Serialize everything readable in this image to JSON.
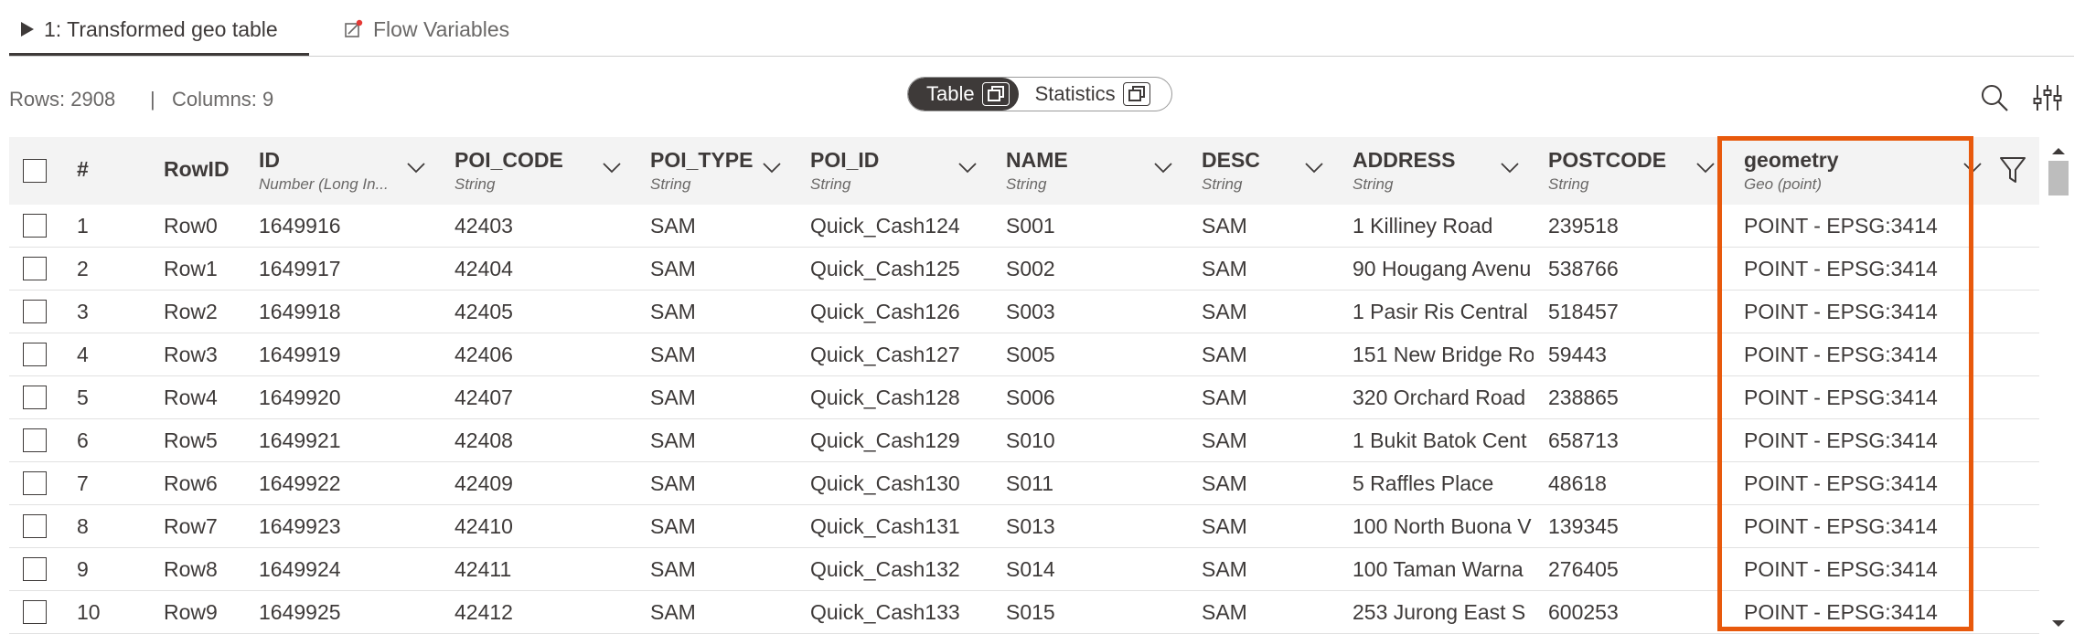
{
  "tabs": [
    {
      "label": "1: Transformed geo table",
      "icon": "play-icon"
    },
    {
      "label": "Flow Variables",
      "icon": "flow-variable-icon"
    }
  ],
  "info": {
    "rows": "Rows: 2908",
    "separator": "|",
    "columns": "Columns: 9"
  },
  "view_toggle": {
    "table": "Table",
    "statistics": "Statistics",
    "selected": "Table"
  },
  "columns": [
    {
      "name": "#"
    },
    {
      "name": "RowID"
    },
    {
      "name": "ID",
      "type": "Number (Long In..."
    },
    {
      "name": "POI_CODE",
      "type": "String"
    },
    {
      "name": "POI_TYPE",
      "type": "String"
    },
    {
      "name": "POI_ID",
      "type": "String"
    },
    {
      "name": "NAME",
      "type": "String"
    },
    {
      "name": "DESC",
      "type": "String"
    },
    {
      "name": "ADDRESS",
      "type": "String"
    },
    {
      "name": "POSTCODE",
      "type": "String"
    },
    {
      "name": "geometry",
      "type": "Geo (point)"
    }
  ],
  "rows": [
    [
      "1",
      "Row0",
      "1649916",
      "42403",
      "SAM",
      "Quick_Cash124",
      "S001",
      "SAM",
      "1 Killiney Road",
      "239518",
      "POINT - EPSG:3414"
    ],
    [
      "2",
      "Row1",
      "1649917",
      "42404",
      "SAM",
      "Quick_Cash125",
      "S002",
      "SAM",
      "90 Hougang Avenu",
      "538766",
      "POINT - EPSG:3414"
    ],
    [
      "3",
      "Row2",
      "1649918",
      "42405",
      "SAM",
      "Quick_Cash126",
      "S003",
      "SAM",
      "1 Pasir Ris Central",
      "518457",
      "POINT - EPSG:3414"
    ],
    [
      "4",
      "Row3",
      "1649919",
      "42406",
      "SAM",
      "Quick_Cash127",
      "S005",
      "SAM",
      "151 New Bridge Ro",
      "59443",
      "POINT - EPSG:3414"
    ],
    [
      "5",
      "Row4",
      "1649920",
      "42407",
      "SAM",
      "Quick_Cash128",
      "S006",
      "SAM",
      "320 Orchard Road",
      "238865",
      "POINT - EPSG:3414"
    ],
    [
      "6",
      "Row5",
      "1649921",
      "42408",
      "SAM",
      "Quick_Cash129",
      "S010",
      "SAM",
      "1 Bukit Batok Cent",
      "658713",
      "POINT - EPSG:3414"
    ],
    [
      "7",
      "Row6",
      "1649922",
      "42409",
      "SAM",
      "Quick_Cash130",
      "S011",
      "SAM",
      "5 Raffles Place",
      "48618",
      "POINT - EPSG:3414"
    ],
    [
      "8",
      "Row7",
      "1649923",
      "42410",
      "SAM",
      "Quick_Cash131",
      "S013",
      "SAM",
      "100 North Buona V",
      "139345",
      "POINT - EPSG:3414"
    ],
    [
      "9",
      "Row8",
      "1649924",
      "42411",
      "SAM",
      "Quick_Cash132",
      "S014",
      "SAM",
      "100 Taman Warna",
      "276405",
      "POINT - EPSG:3414"
    ],
    [
      "10",
      "Row9",
      "1649925",
      "42412",
      "SAM",
      "Quick_Cash133",
      "S015",
      "SAM",
      "253 Jurong East S",
      "600253",
      "POINT - EPSG:3414"
    ]
  ],
  "colors": {
    "highlight": "#e8590c",
    "text": "#3e3a39",
    "header_bg": "#f3f3f3"
  }
}
